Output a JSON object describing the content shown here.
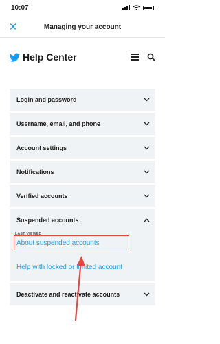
{
  "status_bar": {
    "time": "10:07"
  },
  "nav": {
    "title": "Managing your account",
    "close_icon": "close-icon"
  },
  "help_header": {
    "title": "Help Center",
    "logo_icon": "bird-icon",
    "menu_icon": "hamburger-icon",
    "search_icon": "search-icon"
  },
  "accordion": {
    "items": [
      {
        "label": "Login and password"
      },
      {
        "label": "Username, email, and phone"
      },
      {
        "label": "Account settings"
      },
      {
        "label": "Notifications"
      },
      {
        "label": "Verified accounts"
      },
      {
        "label": "Suspended accounts"
      },
      {
        "label": "Deactivate and reactivate accounts"
      }
    ],
    "expanded": {
      "last_viewed": "LAST VIEWED",
      "links": [
        {
          "label": "About suspended accounts"
        },
        {
          "label": "Help with locked or limited account"
        }
      ]
    }
  },
  "colors": {
    "accent": "#1d9bf0",
    "annotation": "#e8453c",
    "row_bg": "#f0f3f5"
  }
}
